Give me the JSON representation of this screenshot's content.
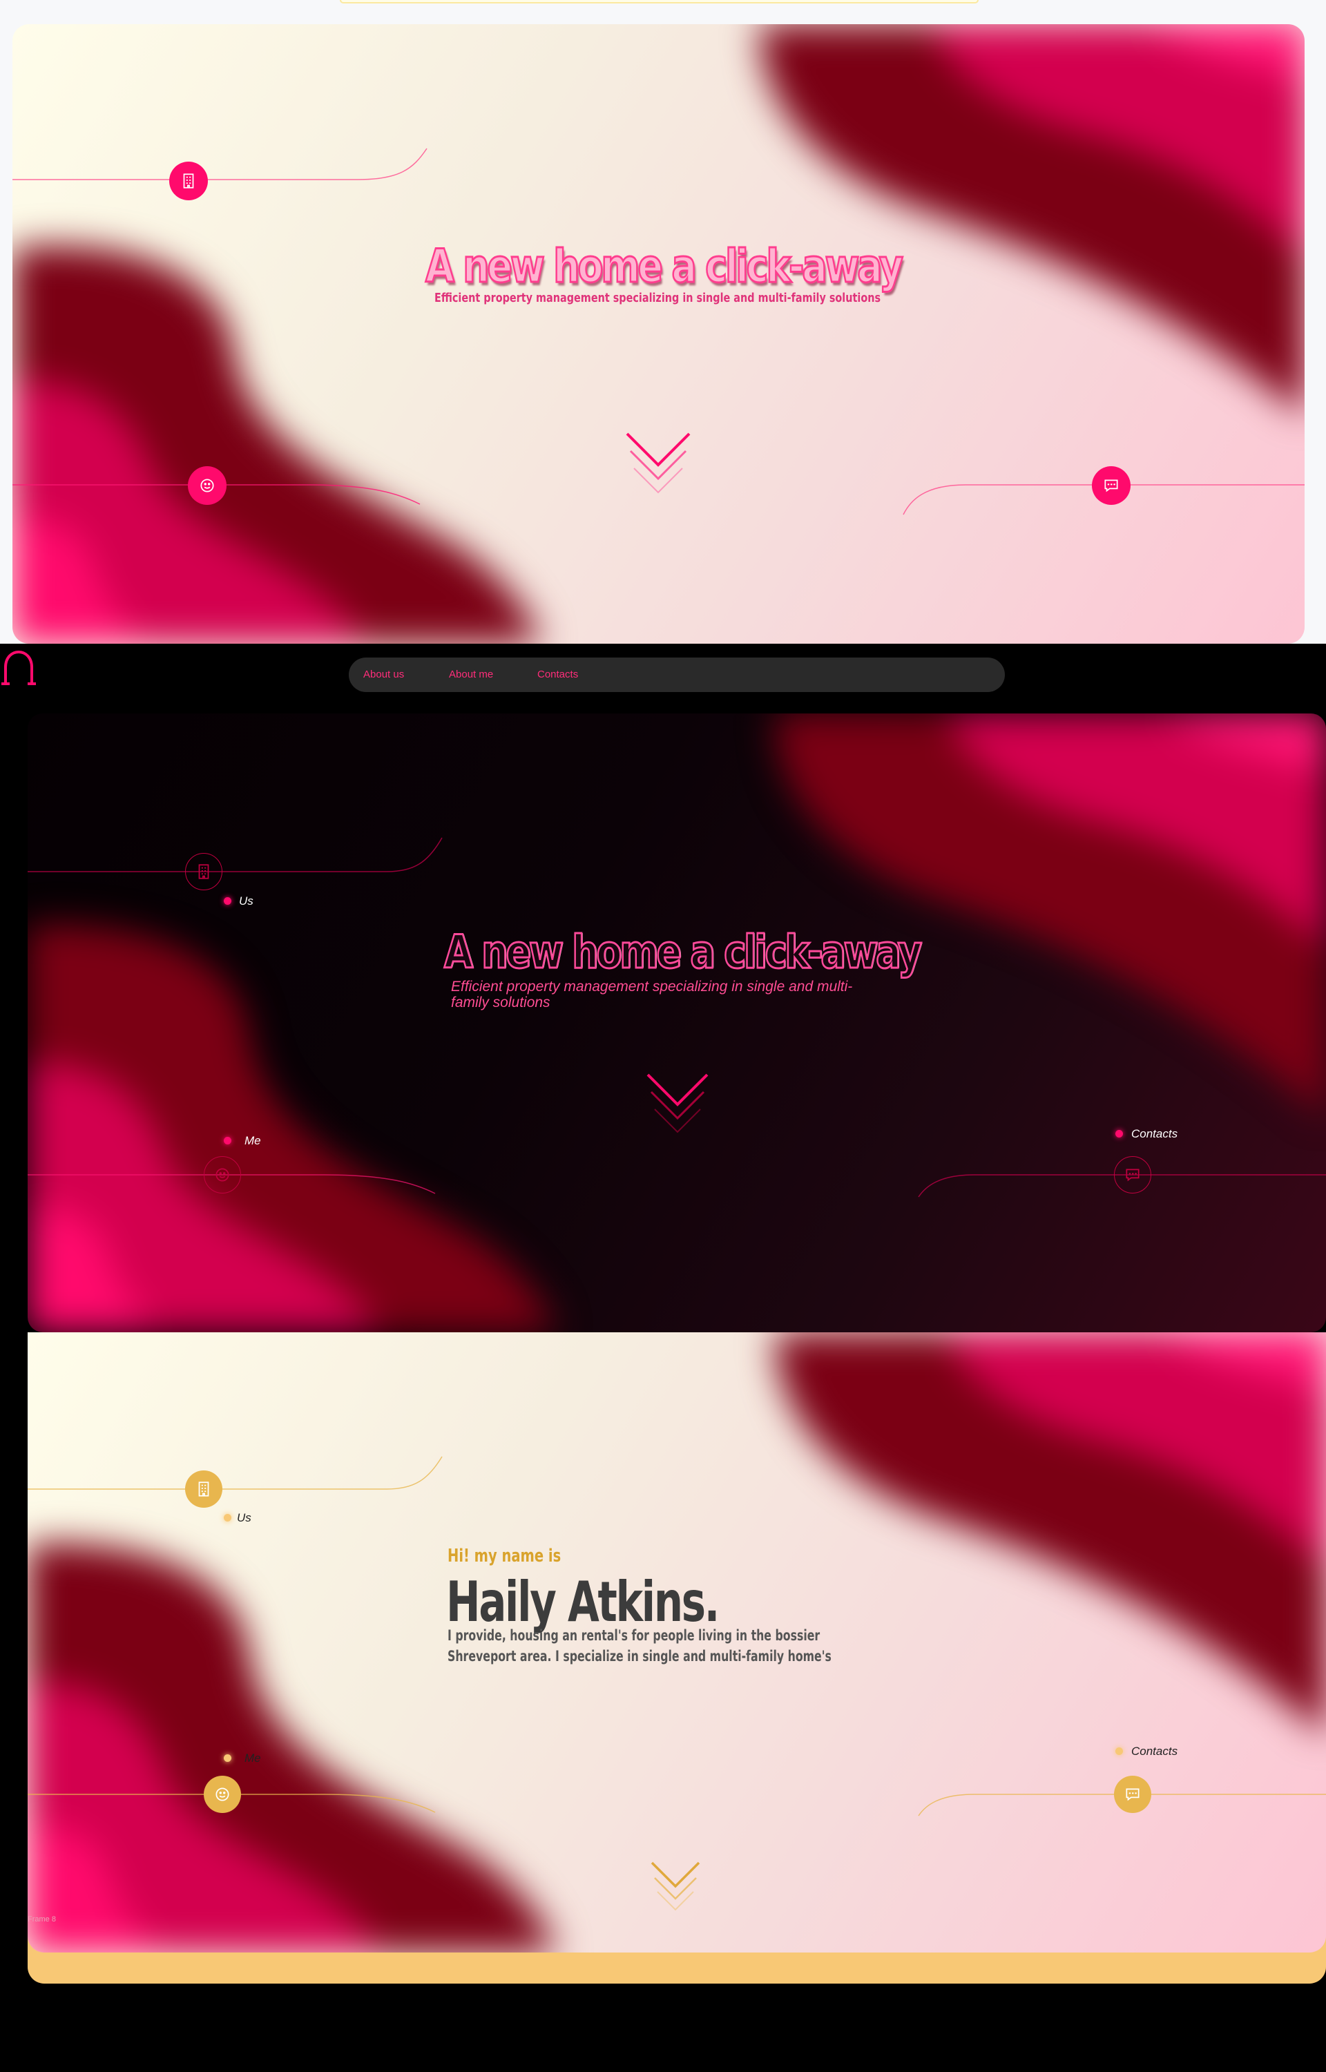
{
  "hero": {
    "title": "A new home a click-away",
    "subtitle": "Efficient property management specializing in single and multi-family solutions",
    "subtitle_dark": "Efficient property management specializing in single and multi-family solutions"
  },
  "nav": {
    "items": [
      {
        "label": "About us"
      },
      {
        "label": "About me"
      },
      {
        "label": "Contacts"
      }
    ]
  },
  "markers": {
    "us": "Us",
    "me": "Me",
    "contacts": "Contacts"
  },
  "about": {
    "greeting": "Hi! my name is",
    "name": "Haily Atkins.",
    "bio": "I provide, housing an rental's for people living in the bossier Shreveport area. I specialize in single and multi-family home's",
    "frame_label": "Frame 8"
  },
  "icons": [
    "building-icon",
    "smiley-icon",
    "chat-icon",
    "chevron-down-icon",
    "horseshoe-logo-icon"
  ],
  "colors": {
    "accent_pink": "#ff0a6c",
    "dark_red": "#7a0015",
    "gold": "#e8b64e",
    "cream": "#fffdea",
    "light_pink": "#fdc5d4",
    "footer_gold": "#f8c875"
  }
}
